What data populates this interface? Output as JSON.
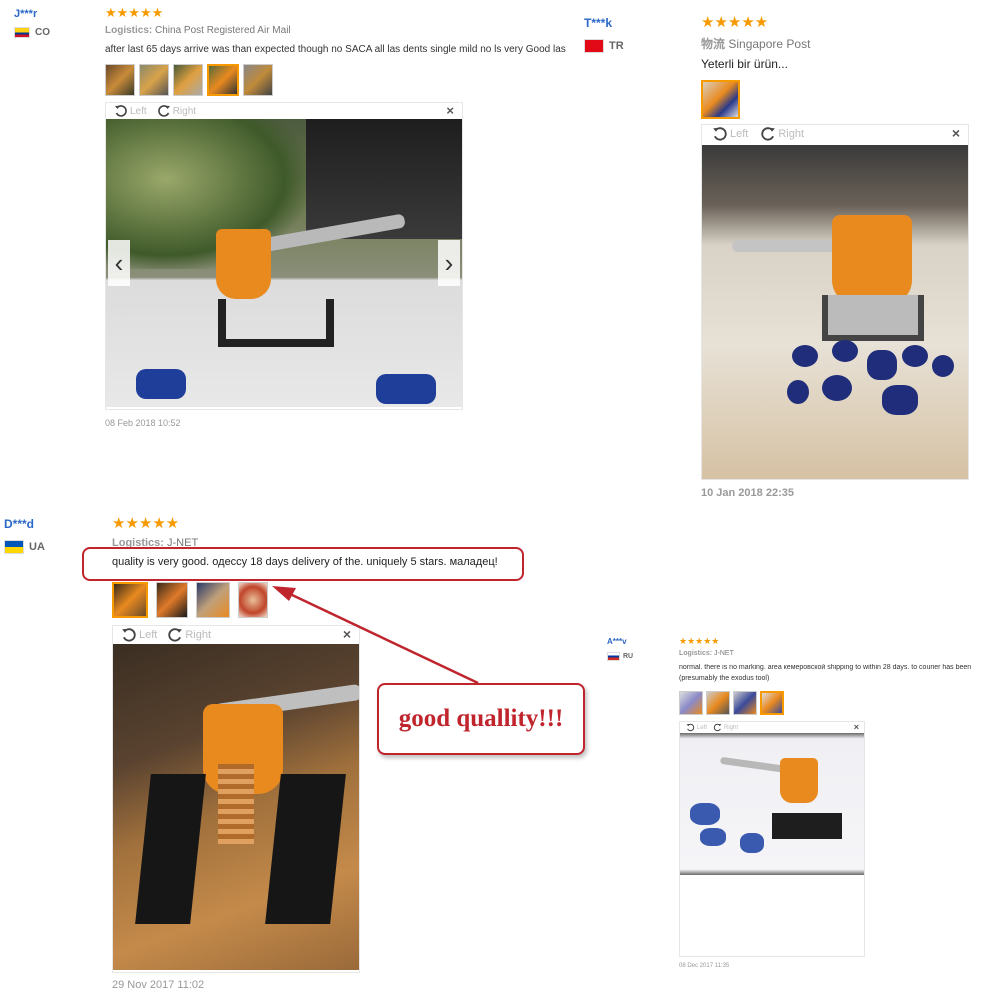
{
  "reviews": [
    {
      "user": "J***r",
      "country": "CO",
      "stars": "★★★★★",
      "logistics_label": "Logistics:",
      "logistics": "China Post Registered Air Mail",
      "text": "after last 65 days arrive was than expected though no SACA all las dents single mild no ls very Good las",
      "viewer_left": "Left",
      "viewer_right": "Right",
      "close": "×",
      "prev": "‹",
      "next": "›",
      "date": "08 Feb 2018 10:52"
    },
    {
      "user": "T***k",
      "country": "TR",
      "stars": "★★★★★",
      "logistics_label": "物流",
      "logistics": "Singapore Post",
      "text": "Yeterli bir ürün...",
      "viewer_left": "Left",
      "viewer_right": "Right",
      "close": "×",
      "date": "10 Jan 2018 22:35"
    },
    {
      "user": "D***d",
      "country": "UA",
      "stars": "★★★★★",
      "logistics_label": "Logistics:",
      "logistics": "J-NET",
      "text": "quality is very good. одессу 18 days delivery of the. uniquely 5 stars. маладец!",
      "viewer_left": "Left",
      "viewer_right": "Right",
      "close": "×",
      "date": "29 Nov 2017 11:02"
    },
    {
      "user": "A***v",
      "country": "RU",
      "stars": "★★★★★",
      "logistics_label": "Logistics:",
      "logistics": "J-NET",
      "text": "normal. there is no marking. area кемеровской shipping to within 28 days. to courier has been",
      "text2": "(presumably the exodus tool)",
      "viewer_left": "Left",
      "viewer_right": "Right",
      "close": "×",
      "date": "08 Dec 2017 11:35"
    }
  ],
  "annotation": {
    "text": "good quallity!!!",
    "color": "#c0252d"
  },
  "colors": {
    "username": "#2a67c6",
    "stars": "#f79a00",
    "tool_orange": "#e98a1f"
  }
}
